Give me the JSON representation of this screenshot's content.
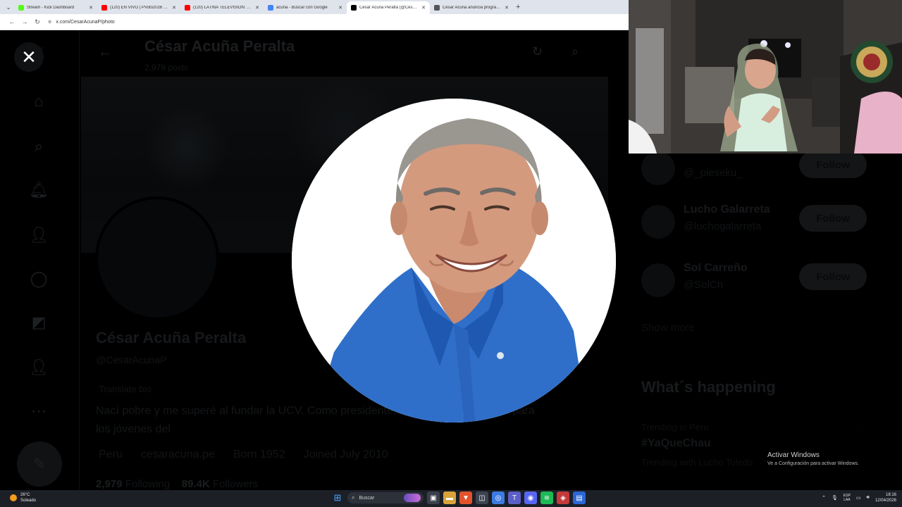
{
  "browser": {
    "tabs": [
      {
        "title": "Stream - Kick Dashboard",
        "favicon_color": "#53fc18",
        "active": false
      },
      {
        "title": "(120) EN VIVO | PVoto2026 Tra...",
        "favicon_color": "#ff0000",
        "active": false
      },
      {
        "title": "(120) LATINA TELEVISION: ELE...",
        "favicon_color": "#ff0000",
        "active": false
      },
      {
        "title": "acuña - Buscar con Google",
        "favicon_color": "#4285f4",
        "active": false
      },
      {
        "title": "César Acuña Peralta (@CesarA...",
        "favicon_color": "#000000",
        "active": true
      },
      {
        "title": "César Acuña anuncia programa...",
        "favicon_color": "#555555",
        "active": false
      }
    ],
    "url": "x.com/CesarAcunaP/photo"
  },
  "profile": {
    "header_name": "César Acuña Peralta",
    "header_posts": "2,979 posts",
    "name": "César Acuña Peralta",
    "handle": "@CesarAcunaP",
    "translate": "Translate bio",
    "bio": "Nací pobre y me superé al fundar la UCV. Como presidente, lograré oportunidades para los jóvenes del",
    "location": "Peru",
    "website": "cesaracuna.pe",
    "born": "Born 1952",
    "joined": "Joined July 2010",
    "following_count": "2,979",
    "following_label": "Following",
    "followers_count": "89.4K",
    "followers_label": "Followers"
  },
  "suggestions": [
    {
      "name": "",
      "handle": "@_pieseku_",
      "button": "Follow"
    },
    {
      "name": "Lucho Galarreta",
      "handle": "@luchogalarreta",
      "button": "Follow"
    },
    {
      "name": "Sol Carreño",
      "handle": "@SolCn",
      "button": "Follow"
    }
  ],
  "show_more": "Show more",
  "whats_happening": "What´s happening",
  "trend": {
    "context": "Trending in Peru",
    "tag": "#YaQueChau",
    "footer": "Trending with Lucho Toledo"
  },
  "overlay": {
    "close_icon": "✕"
  },
  "windows_activation": {
    "title": "Activar Windows",
    "subtitle": "Ve a Configuración para activar Windows."
  },
  "taskbar": {
    "temperature": "26°C",
    "weather": "Soleado",
    "search_placeholder": "Buscar",
    "lang_top": "ESP",
    "lang_bottom": "LAA",
    "time": "18:16",
    "date": "12/04/2026"
  }
}
